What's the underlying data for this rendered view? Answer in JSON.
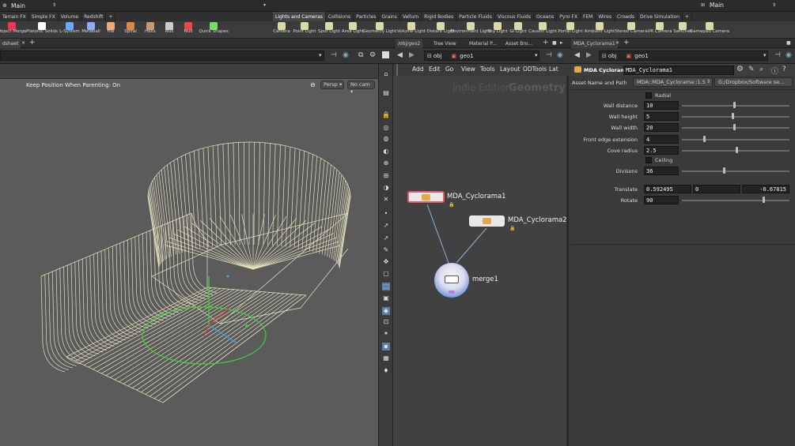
{
  "topbar": {
    "desktop_left": "Main",
    "desktop_right": "Main"
  },
  "shelf_tabs_left": [
    "Terrain FX",
    "Simple FX",
    "Volume",
    "Redshift",
    "+"
  ],
  "shelf_tabs_right": [
    "Lights and Cameras",
    "Collisions",
    "Particles",
    "Grains",
    "Vellum",
    "Rigid Bodies",
    "Particle Fluids",
    "Viscous Fluids",
    "Oceans",
    "Pyro FX",
    "FEM",
    "Wires",
    "Crowds",
    "Drive Simulation",
    "+"
  ],
  "tools_left": [
    "Object Merge",
    "Platonic Solids",
    "L-System",
    "Metaball",
    "File",
    "Spiral",
    "Helix",
    "Null",
    "Null",
    "Quick Shapes"
  ],
  "tools_right": [
    "Camera",
    "Point Light",
    "Spot Light",
    "Area Light",
    "Geometry Light",
    "Volume Light",
    "Distant Light",
    "Environment Light",
    "Sky Light",
    "GI Light",
    "Caustic Light",
    "Portal Light",
    "Ambient Light",
    "Stereo Camera",
    "VR Camera",
    "Switcher",
    "Gamepad Camera"
  ],
  "pane_tabs": {
    "left": "dsheet",
    "mid": [
      "/obj/geo2",
      "Tree View",
      "Material P...",
      "Asset Bro..."
    ],
    "right": "MDA_Cyclorama1"
  },
  "network_path": {
    "obj": "obj",
    "geo": "geo1"
  },
  "param_path": {
    "obj": "obj",
    "geo": "geo1"
  },
  "viewport": {
    "status": "Keep Position When Parenting: On",
    "persp": "Persp",
    "cam": "No cam"
  },
  "network_menu": [
    "Add",
    "Edit",
    "Go",
    "View",
    "Tools",
    "Layout",
    "ODTools",
    "Lat"
  ],
  "network_watermark": {
    "edition": "Indie Edition",
    "context": "Geometry"
  },
  "nodes": [
    {
      "label": "MDA_Cyclorama1"
    },
    {
      "label": "MDA_Cyclorama2"
    },
    {
      "label": "merge1"
    }
  ],
  "params": {
    "node_type": "MDA Cyclorama",
    "node_name": "MDA_Cyclorama1",
    "asset_label": "Asset Name and Path",
    "asset_name": "MDA::MDA_Cyclorama::1.5",
    "asset_path": "G:/Dropbox/Software se...",
    "radial_label": "Radial",
    "ceiling_label": "Ceiling",
    "rows": [
      {
        "label": "Wall distance",
        "value": "10",
        "level": 0.48
      },
      {
        "label": "Wall height",
        "value": "5",
        "level": 0.46
      },
      {
        "label": "Wall width",
        "value": "20",
        "level": 0.48
      },
      {
        "label": "Front edge extension",
        "value": "4",
        "level": 0.2
      },
      {
        "label": "Cove radius",
        "value": "2.5",
        "level": 0.5
      }
    ],
    "divisions": {
      "label": "Divisons",
      "value": "36",
      "level": 0.38
    },
    "translate": {
      "label": "Translate",
      "x": "0.592495",
      "y": "0",
      "z": "-6.67015"
    },
    "rotate": {
      "label": "Rotate",
      "value": "90",
      "level": 0.75
    }
  }
}
